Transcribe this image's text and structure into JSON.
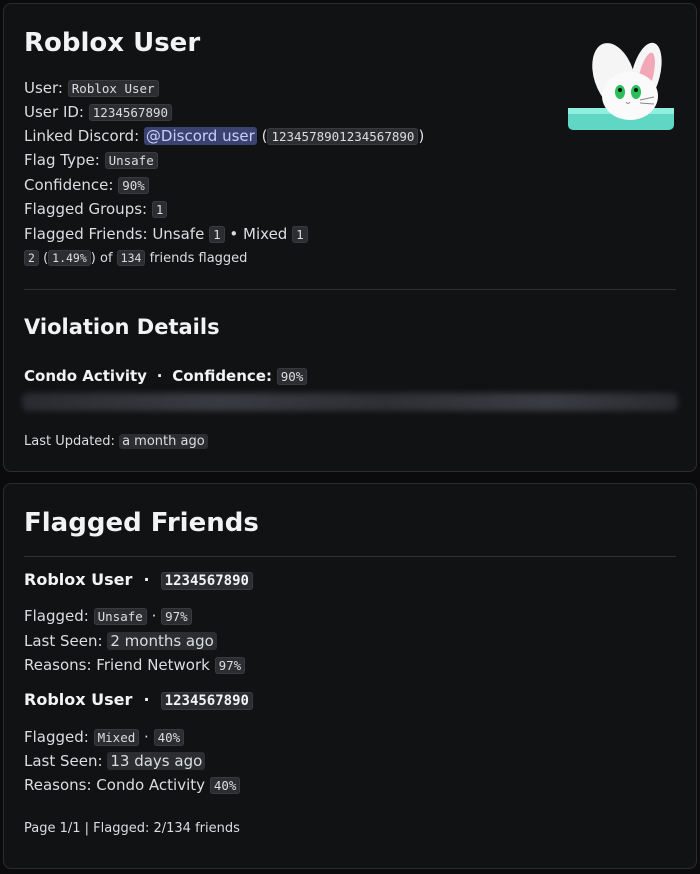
{
  "user_card": {
    "title": "Roblox User",
    "user_label": "User:",
    "user_value": "Roblox User",
    "user_id_label": "User ID:",
    "user_id_value": "1234567890",
    "discord_label": "Linked Discord:",
    "discord_mention": "@Discord user",
    "discord_paren_open": "(",
    "discord_id": "1234578901234567890",
    "discord_paren_close": ")",
    "flag_type_label": "Flag Type:",
    "flag_type_value": "Unsafe",
    "confidence_label": "Confidence:",
    "confidence_value": "90%",
    "flagged_groups_label": "Flagged Groups:",
    "flagged_groups_value": "1",
    "flagged_friends_label": "Flagged Friends: Unsafe",
    "flagged_friends_unsafe": "1",
    "flagged_friends_mixed_label": "• Mixed",
    "flagged_friends_mixed": "1",
    "friends_flagged_count": "2",
    "friends_flagged_pct_open": "(",
    "friends_flagged_pct": "1.49%",
    "friends_flagged_pct_close": ") of",
    "friends_total": "134",
    "friends_flagged_suffix": "friends flagged"
  },
  "violation": {
    "title": "Violation Details",
    "category": "Condo Activity",
    "separator": "·",
    "confidence_label": "Confidence:",
    "confidence_value": "90%",
    "last_updated_label": "Last Updated:",
    "last_updated_value": "a month ago"
  },
  "friends_card": {
    "title": "Flagged Friends",
    "friends": [
      {
        "name": "Roblox User",
        "separator": "·",
        "id": "1234567890",
        "flagged_label": "Flagged:",
        "flag": "Unsafe",
        "dot": "·",
        "confidence": "97%",
        "last_seen_label": "Last Seen:",
        "last_seen": "2 months ago",
        "reasons_label": "Reasons: Friend Network",
        "reasons_confidence": "97%"
      },
      {
        "name": "Roblox User",
        "separator": "·",
        "id": "1234567890",
        "flagged_label": "Flagged:",
        "flag": "Mixed",
        "dot": "·",
        "confidence": "40%",
        "last_seen_label": "Last Seen:",
        "last_seen": "13 days ago",
        "reasons_label": "Reasons: Condo Activity",
        "reasons_confidence": "40%"
      }
    ],
    "footer": "Page 1/1 | Flagged: 2/134 friends"
  },
  "colors": {
    "background": "#0b0b0d",
    "card": "#111214",
    "mention": "#3c4270",
    "code_bg": "#2b2d31"
  },
  "icons": {
    "avatar": "white-bunny-avatar-icon"
  }
}
